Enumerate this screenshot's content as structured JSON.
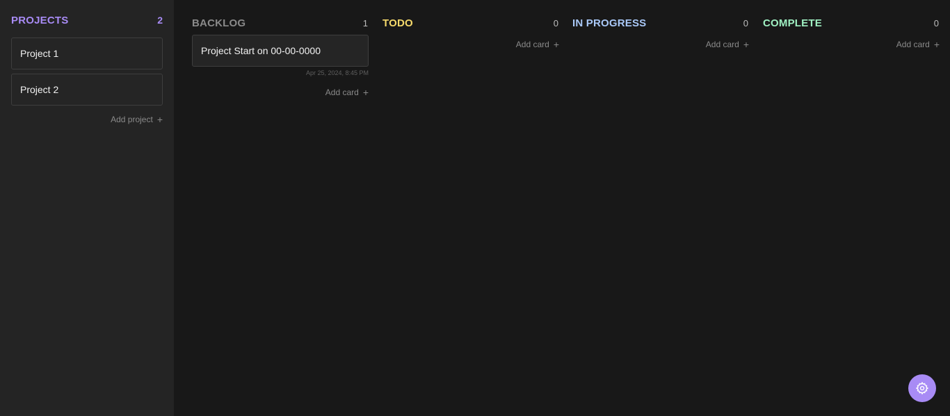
{
  "sidebar": {
    "title": "PROJECTS",
    "count": "2",
    "projects": [
      {
        "label": "Project 1"
      },
      {
        "label": "Project 2"
      }
    ],
    "add_label": "Add project",
    "accent": "#a88bf5"
  },
  "columns": [
    {
      "title": "BACKLOG",
      "count": "1",
      "color": "#8a8a8a",
      "cards": [
        {
          "label": "Project Start on 00-00-0000",
          "date": "Apr 25, 2024, 8:45 PM"
        }
      ],
      "add_label": "Add card"
    },
    {
      "title": "TODO",
      "count": "0",
      "color": "#f5d96b",
      "cards": [],
      "add_label": "Add card"
    },
    {
      "title": "IN PROGRESS",
      "count": "0",
      "color": "#a9c8f7",
      "cards": [],
      "add_label": "Add card"
    },
    {
      "title": "COMPLETE",
      "count": "0",
      "color": "#9ff0c2",
      "cards": [],
      "add_label": "Add card"
    }
  ],
  "icons": {
    "add": "plus-icon",
    "settings": "gear-icon"
  }
}
